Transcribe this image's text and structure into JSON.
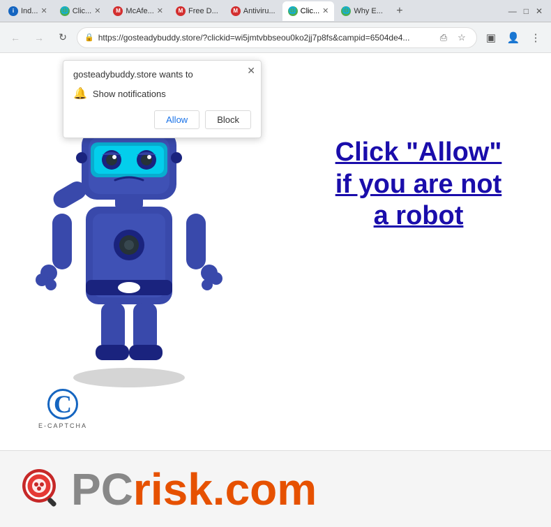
{
  "titlebar": {
    "tabs": [
      {
        "label": "Ind...",
        "favicon": "blue",
        "active": false
      },
      {
        "label": "Clic...",
        "favicon": "globe",
        "active": false
      },
      {
        "label": "McAfe...",
        "favicon": "red",
        "active": false
      },
      {
        "label": "Free D...",
        "favicon": "red",
        "active": false
      },
      {
        "label": "Antiviru...",
        "favicon": "red",
        "active": false
      },
      {
        "label": "Clic...",
        "favicon": "globe",
        "active": true
      },
      {
        "label": "Why E...",
        "favicon": "globe",
        "active": false
      }
    ],
    "controls": {
      "minimize": "—",
      "maximize": "□",
      "close": "✕"
    }
  },
  "addressbar": {
    "back_label": "←",
    "forward_label": "→",
    "reload_label": "↻",
    "url": "https://gosteadybuddy.store/?clickid=wi5jmtvbbseou0ko2jj7p8fs&campid=6504de4...",
    "share_icon": "share",
    "bookmark_icon": "★",
    "extension_icon": "▣",
    "profile_icon": "👤",
    "menu_icon": "⋮"
  },
  "notification": {
    "title": "gosteadybuddy.store wants to",
    "permission_text": "Show notifications",
    "allow_label": "Allow",
    "block_label": "Block",
    "close_label": "✕"
  },
  "page": {
    "click_allow_text": "Click \"Allow\" if you are not a robot",
    "captcha_letter": "C",
    "captcha_label": "E-CAPTCHA",
    "pcrisk_text_gray": "PC",
    "pcrisk_text_orange": "risk.com"
  }
}
